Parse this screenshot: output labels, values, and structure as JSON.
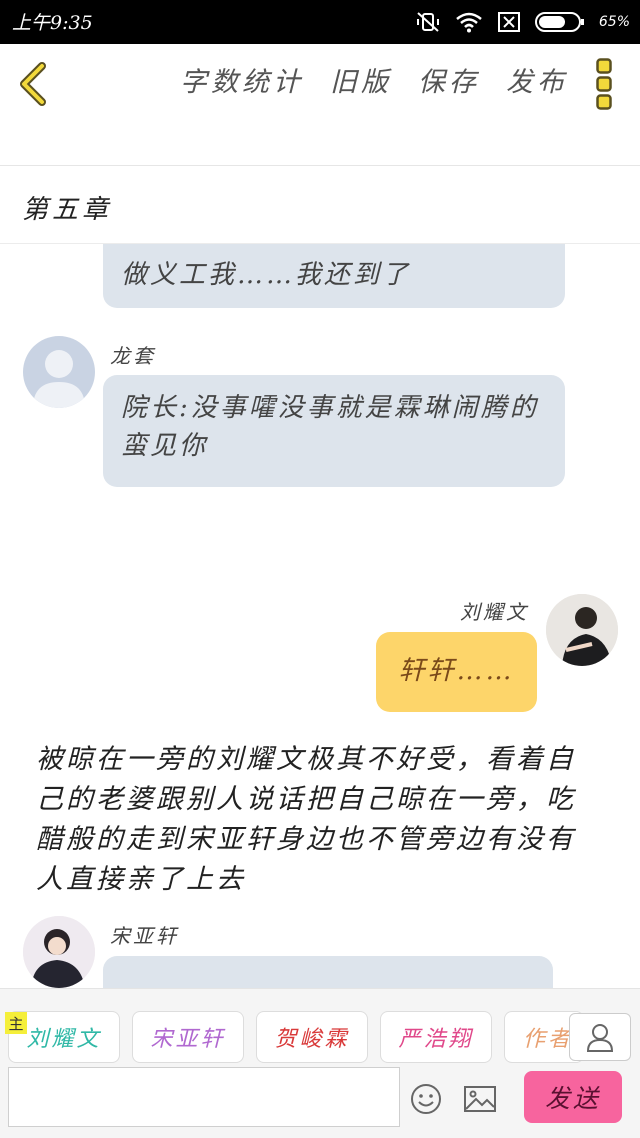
{
  "status_bar": {
    "time": "上午9:35",
    "battery_percent": "65%",
    "icons": [
      "vibrate-off-icon",
      "wifi-icon",
      "sim-x-icon",
      "battery-icon"
    ]
  },
  "toolbar": {
    "back_icon": "chevron-left-icon",
    "word_count": "字数统计",
    "old_version": "旧版",
    "save": "保存",
    "publish": "发布",
    "more_icon": "vertical-dots-icon",
    "accent_color": "#f2d93b"
  },
  "chapter": {
    "title": "第五章"
  },
  "messages": [
    {
      "side": "left",
      "speaker": "",
      "text": "做义工我……我还到了",
      "partial": true
    },
    {
      "side": "left",
      "speaker": "龙套",
      "avatar": "default-avatar-icon",
      "text": "院长:没事嚯没事就是霖琳闹腾的蛮见你"
    },
    {
      "side": "right",
      "speaker": "刘耀文",
      "avatar": "user-photo",
      "text": "轩轩……"
    },
    {
      "type": "narration",
      "text": "被晾在一旁的刘耀文极其不好受，看着自己的老婆跟别人说话把自己晾在一旁，吃醋般的走到宋亚轩身边也不管旁边有没有人直接亲了上去"
    },
    {
      "side": "left",
      "speaker": "宋亚轩",
      "avatar": "user-photo",
      "text": "",
      "partial": true
    }
  ],
  "bottom_bar": {
    "main_badge": "主",
    "roles": [
      {
        "label": "刘耀文",
        "color": "#2fb8a6"
      },
      {
        "label": "宋亚轩",
        "color": "#b068d0"
      },
      {
        "label": "贺峻霖",
        "color": "#d93a3a"
      },
      {
        "label": "严浩翔",
        "color": "#e0488a"
      },
      {
        "label": "作者",
        "color": "#e8a070"
      }
    ],
    "person_icon": "person-icon",
    "input_placeholder": "",
    "emoji_icon": "smiley-icon",
    "image_icon": "image-icon",
    "send_label": "发送",
    "send_color": "#f7649e"
  }
}
